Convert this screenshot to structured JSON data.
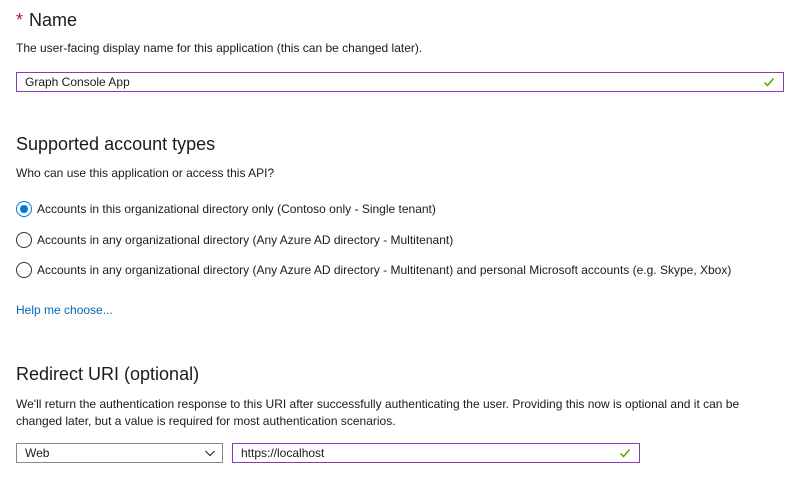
{
  "name_section": {
    "required_mark": "*",
    "title": "Name",
    "description": "The user-facing display name for this application (this can be changed later).",
    "input_value": "Graph Console App"
  },
  "account_section": {
    "title": "Supported account types",
    "question": "Who can use this application or access this API?",
    "options": [
      {
        "label": "Accounts in this organizational directory only (Contoso only - Single tenant)",
        "selected": true
      },
      {
        "label": "Accounts in any organizational directory (Any Azure AD directory - Multitenant)",
        "selected": false
      },
      {
        "label": "Accounts in any organizational directory (Any Azure AD directory - Multitenant) and personal Microsoft accounts (e.g. Skype, Xbox)",
        "selected": false
      }
    ],
    "help_link": "Help me choose..."
  },
  "redirect_section": {
    "title": "Redirect URI (optional)",
    "description": "We'll return the authentication response to this URI after successfully authenticating the user. Providing this now is optional and it can be changed later, but a value is required for most authentication scenarios.",
    "platform_value": "Web",
    "uri_value": "https://localhost"
  },
  "colors": {
    "accent": "#0078d4",
    "link": "#0067b8",
    "input_border_focus": "#8a3ab0",
    "valid_check": "#57a300",
    "required": "#c50f1f"
  },
  "icons": {
    "valid": "checkmark-icon",
    "dropdown": "chevron-down-icon"
  }
}
